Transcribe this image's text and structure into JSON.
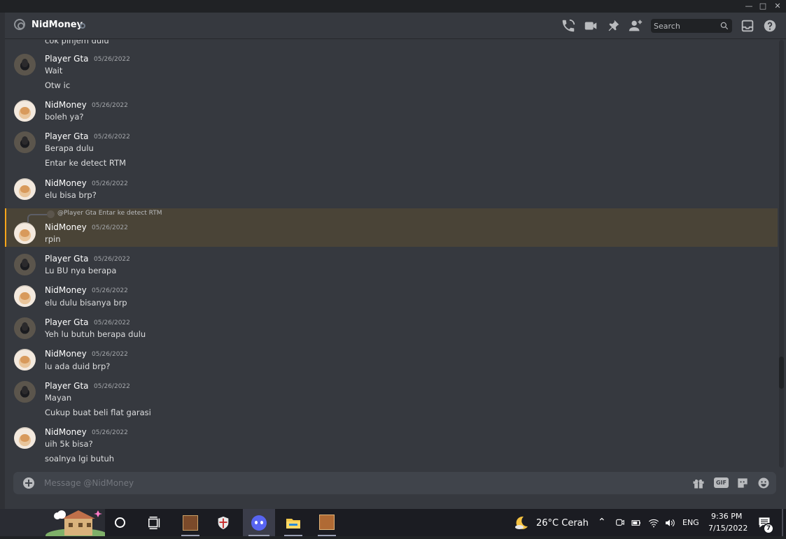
{
  "header": {
    "title": "NidMoney",
    "search_placeholder": "Search"
  },
  "messages": [
    {
      "author": "",
      "timestamp": "",
      "lines": [
        "cok pinjem dulu"
      ]
    },
    {
      "author": "Player Gta",
      "timestamp": "05/26/2022",
      "lines": [
        "Wait",
        "Otw ic"
      ]
    },
    {
      "author": "NidMoney",
      "timestamp": "05/26/2022",
      "lines": [
        "boleh ya?"
      ]
    },
    {
      "author": "Player Gta",
      "timestamp": "05/26/2022",
      "lines": [
        "Berapa dulu",
        "Entar ke detect RTM"
      ]
    },
    {
      "author": "NidMoney",
      "timestamp": "05/26/2022",
      "lines": [
        "elu bisa brp?"
      ]
    },
    {
      "author": "NidMoney",
      "timestamp": "05/26/2022",
      "lines": [
        "rpin"
      ],
      "reply": "@Player Gta Entar ke detect RTM"
    },
    {
      "author": "Player Gta",
      "timestamp": "05/26/2022",
      "lines": [
        "Lu BU nya berapa"
      ]
    },
    {
      "author": "NidMoney",
      "timestamp": "05/26/2022",
      "lines": [
        "elu dulu bisanya brp"
      ]
    },
    {
      "author": "Player Gta",
      "timestamp": "05/26/2022",
      "lines": [
        "Yeh lu butuh berapa dulu"
      ]
    },
    {
      "author": "NidMoney",
      "timestamp": "05/26/2022",
      "lines": [
        "lu ada duid brp?"
      ]
    },
    {
      "author": "Player Gta",
      "timestamp": "05/26/2022",
      "lines": [
        "Mayan",
        "Cukup buat beli flat garasi"
      ]
    },
    {
      "author": "NidMoney",
      "timestamp": "05/26/2022",
      "lines": [
        "uih 5k bisa?",
        "soalnya lgi butuh"
      ]
    }
  ],
  "composer": {
    "placeholder": "Message @NidMoney",
    "gif_label": "GIF"
  },
  "taskbar": {
    "weather": "26°C  Cerah",
    "language": "ENG",
    "time": "9:36 PM",
    "date": "7/15/2022",
    "notification_count": "7"
  },
  "colors": {
    "accent_reply": "#faa61a",
    "discord_blurple": "#5865f2"
  }
}
